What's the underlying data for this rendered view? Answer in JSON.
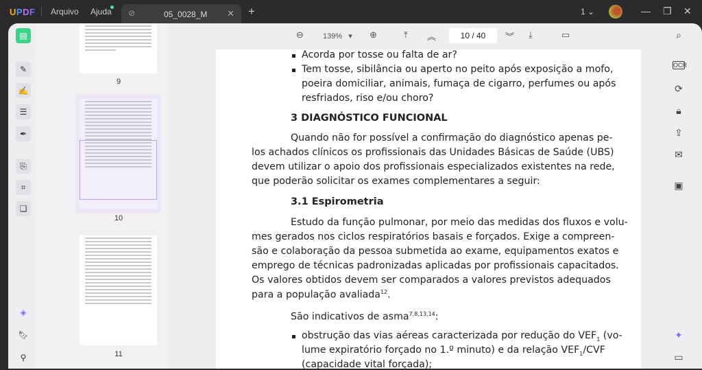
{
  "app": {
    "logo": "UPDF",
    "menu": [
      "Arquivo",
      "Ajuda"
    ],
    "tab_title": "05_0028_M",
    "window_count": "1"
  },
  "toolbar": {
    "zoom": "139%",
    "page_current": "10",
    "page_total": "40",
    "page_display": "10 / 40"
  },
  "thumbnails": [
    {
      "label": "9"
    },
    {
      "label": "10"
    },
    {
      "label": "11"
    }
  ],
  "document": {
    "bullet1": "Acorda por tosse ou falta de ar?",
    "bullet2": [
      "Tem tosse, sibilância ou aperto no peito após exposição a mofo,",
      "poeira domiciliar, animais, fumaça de cigarro, perfumes ou após",
      "resfriados, riso e/ou choro?"
    ],
    "heading3": "3  DIAGNÓSTICO FUNCIONAL",
    "para1": [
      "Quando não for possível a confirmação do diagnóstico apenas pe-",
      "los achados clínicos os profissionais das Unidades Básicas de Saúde (UBS)",
      "devem utilizar o apoio dos profissionais especializados existentes na rede,",
      "que poderão solicitar os exames complementares a seguir:"
    ],
    "heading31": "3.1  Espirometria",
    "para2": [
      "Estudo da função pulmonar, por meio das medidas dos fluxos e volu-",
      "mes gerados nos ciclos respiratórios basais e forçados. Exige a compreen-",
      "são e colaboração da pessoa submetida ao exame, equipamentos exatos e",
      "emprego de técnicas padronizadas aplicadas por profissionais capacitados.",
      "Os valores obtidos devem ser comparados a valores previstos adequados",
      "para a população avaliada"
    ],
    "para2_ref": "12",
    "indicativos": "São indicativos de asma",
    "indicativos_ref": "7,8,13,14",
    "bullet3a": "obstrução das vias aéreas caracterizada por redução do VEF",
    "bullet3a_sub": "1",
    "bullet3a_end": " (vo-",
    "bullet3b": "lume expiratório forçado no 1.º minuto) e da relação VEF",
    "bullet3b_sub": "1",
    "bullet3b_end": "/CVF",
    "bullet3c": "(capacidade vital forçada);"
  }
}
